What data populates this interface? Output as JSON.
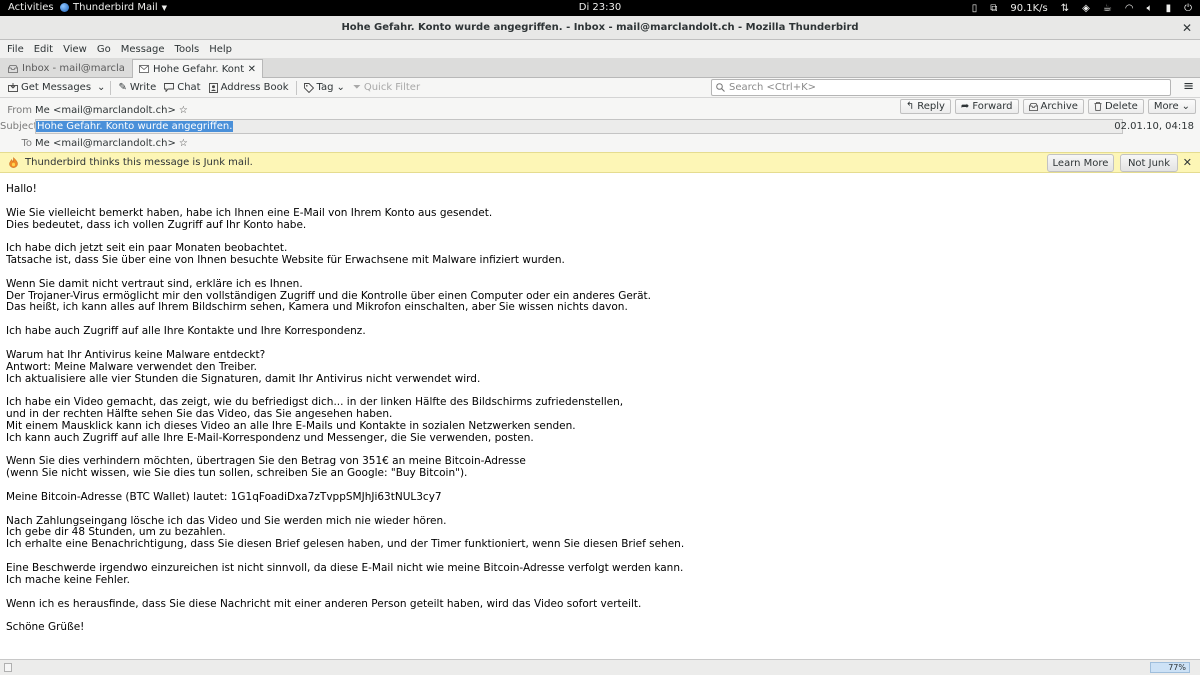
{
  "topbar": {
    "activities": "Activities",
    "app_name": "Thunderbird Mail",
    "clock": "Di 23:30",
    "net_speed": "90.1K/s",
    "icons": [
      "phone-icon",
      "fileshare-icon",
      "network-speed-icon",
      "ethernet-icon",
      "dropbox-icon",
      "tea-icon",
      "wifi-icon",
      "volume-icon",
      "battery-icon",
      "power-icon"
    ]
  },
  "window": {
    "title": "Hohe Gefahr. Konto wurde angegriffen. - Inbox - mail@marclandolt.ch - Mozilla Thunderbird"
  },
  "menubar": [
    "File",
    "Edit",
    "View",
    "Go",
    "Message",
    "Tools",
    "Help"
  ],
  "tabs": [
    {
      "label": "Inbox - mail@marclandolt.ch",
      "icon": "inbox-icon",
      "active": false
    },
    {
      "label": "Hohe Gefahr. Konto wurde angegriffen.",
      "icon": "envelope-icon",
      "active": true
    }
  ],
  "toolbar": {
    "get_messages": "Get Messages",
    "write": "Write",
    "chat": "Chat",
    "address_book": "Address Book",
    "tag": "Tag",
    "quick_filter": "Quick Filter",
    "search_placeholder": "Search <Ctrl+K>"
  },
  "header": {
    "from_label": "From",
    "from_value": "Me <mail@marclandolt.ch>",
    "subject_label": "Subject",
    "subject_value": "Hohe Gefahr. Konto wurde angegriffen.",
    "to_label": "To",
    "to_value": "Me <mail@marclandolt.ch>",
    "date": "02.01.10, 04:18",
    "buttons": {
      "reply": "Reply",
      "forward": "Forward",
      "archive": "Archive",
      "delete": "Delete",
      "more": "More"
    }
  },
  "junkbar": {
    "text": "Thunderbird thinks this message is Junk mail.",
    "learn_more": "Learn More",
    "not_junk": "Not Junk"
  },
  "body": "Hallo!\n\nWie Sie vielleicht bemerkt haben, habe ich Ihnen eine E-Mail von Ihrem Konto aus gesendet.\nDies bedeutet, dass ich vollen Zugriff auf Ihr Konto habe.\n\nIch habe dich jetzt seit ein paar Monaten beobachtet.\nTatsache ist, dass Sie über eine von Ihnen besuchte Website für Erwachsene mit Malware infiziert wurden.\n\nWenn Sie damit nicht vertraut sind, erkläre ich es Ihnen.\nDer Trojaner-Virus ermöglicht mir den vollständigen Zugriff und die Kontrolle über einen Computer oder ein anderes Gerät.\nDas heißt, ich kann alles auf Ihrem Bildschirm sehen, Kamera und Mikrofon einschalten, aber Sie wissen nichts davon.\n\nIch habe auch Zugriff auf alle Ihre Kontakte und Ihre Korrespondenz.\n\nWarum hat Ihr Antivirus keine Malware entdeckt?\nAntwort: Meine Malware verwendet den Treiber.\nIch aktualisiere alle vier Stunden die Signaturen, damit Ihr Antivirus nicht verwendet wird.\n\nIch habe ein Video gemacht, das zeigt, wie du befriedigst dich... in der linken Hälfte des Bildschirms zufriedenstellen,\nund in der rechten Hälfte sehen Sie das Video, das Sie angesehen haben.\nMit einem Mausklick kann ich dieses Video an alle Ihre E-Mails und Kontakte in sozialen Netzwerken senden.\nIch kann auch Zugriff auf alle Ihre E-Mail-Korrespondenz und Messenger, die Sie verwenden, posten.\n\nWenn Sie dies verhindern möchten, übertragen Sie den Betrag von 351€ an meine Bitcoin-Adresse\n(wenn Sie nicht wissen, wie Sie dies tun sollen, schreiben Sie an Google: \"Buy Bitcoin\").\n\nMeine Bitcoin-Adresse (BTC Wallet) lautet: 1G1qFoadiDxa7zTvppSMJhJi63tNUL3cy7\n\nNach Zahlungseingang lösche ich das Video und Sie werden mich nie wieder hören.\nIch gebe dir 48 Stunden, um zu bezahlen.\nIch erhalte eine Benachrichtigung, dass Sie diesen Brief gelesen haben, und der Timer funktioniert, wenn Sie diesen Brief sehen.\n\nEine Beschwerde irgendwo einzureichen ist nicht sinnvoll, da diese E-Mail nicht wie meine Bitcoin-Adresse verfolgt werden kann.\nIch mache keine Fehler.\n\nWenn ich es herausfinde, dass Sie diese Nachricht mit einer anderen Person geteilt haben, wird das Video sofort verteilt.\n\nSchöne Grüße!",
  "statusbar": {
    "progress": "77%"
  }
}
